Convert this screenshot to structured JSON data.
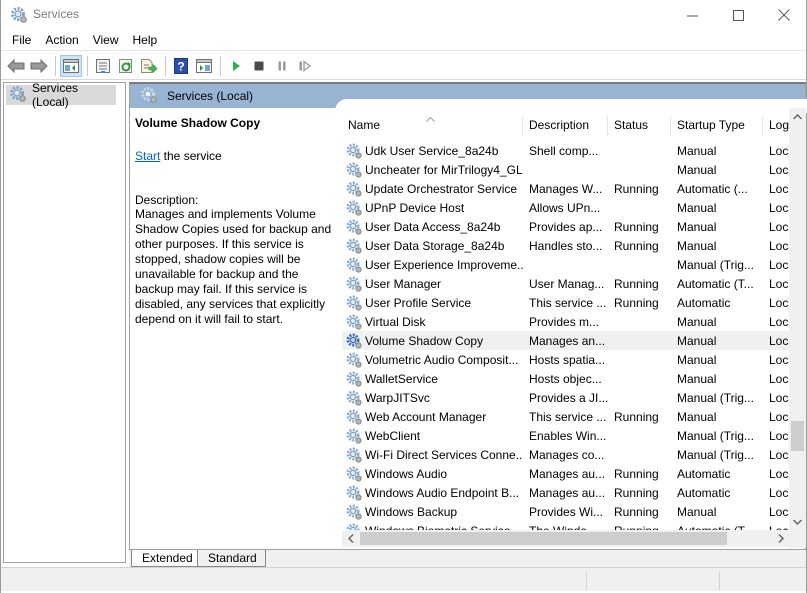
{
  "window": {
    "title": "Services",
    "app_icon": "services-gear-icon",
    "controls": {
      "minimize": "minimize-icon",
      "maximize": "maximize-icon",
      "close": "close-icon"
    }
  },
  "menubar": {
    "items": [
      {
        "label": "File"
      },
      {
        "label": "Action"
      },
      {
        "label": "View"
      },
      {
        "label": "Help"
      }
    ]
  },
  "toolbar": {
    "buttons": [
      {
        "name": "back",
        "icon": "back-arrow-icon"
      },
      {
        "name": "forward",
        "icon": "forward-arrow-icon"
      },
      {
        "name": "show-hide-console-tree",
        "icon": "console-tree-icon",
        "active": true
      },
      {
        "name": "properties",
        "icon": "properties-icon"
      },
      {
        "name": "refresh",
        "icon": "refresh-icon"
      },
      {
        "name": "export-list",
        "icon": "export-list-icon"
      },
      {
        "name": "help",
        "icon": "help-icon"
      },
      {
        "name": "show-hide-action-pane",
        "icon": "action-pane-icon"
      },
      {
        "name": "start-service",
        "icon": "play-icon"
      },
      {
        "name": "stop-service",
        "icon": "stop-icon"
      },
      {
        "name": "pause-service",
        "icon": "pause-icon"
      },
      {
        "name": "resume-service",
        "icon": "resume-icon"
      }
    ]
  },
  "tree": {
    "items": [
      {
        "label": "Services (Local)",
        "selected": true
      }
    ]
  },
  "main": {
    "header": "Services (Local)",
    "detail": {
      "service_name": "Volume Shadow Copy",
      "start_link": "Start",
      "start_suffix": " the service",
      "description_label": "Description:",
      "description": "Manages and implements Volume Shadow Copies used for backup and other purposes. If this service is stopped, shadow copies will be unavailable for backup and the backup may fail. If this service is disabled, any services that explicitly depend on it will fail to start."
    },
    "table": {
      "sort_indicator": "^",
      "columns": [
        "Name",
        "Description",
        "Status",
        "Startup Type",
        "Log"
      ],
      "rows": [
        {
          "name": "Udk User Service_8a24b",
          "description": "Shell comp...",
          "status": "",
          "startup": "Manual",
          "log": "Loca"
        },
        {
          "name": "Uncheater for MirTrilogy4_GL",
          "description": "",
          "status": "",
          "startup": "Manual",
          "log": "Loca"
        },
        {
          "name": "Update Orchestrator Service",
          "description": "Manages W...",
          "status": "Running",
          "startup": "Automatic (...",
          "log": "Loca"
        },
        {
          "name": "UPnP Device Host",
          "description": "Allows UPn...",
          "status": "",
          "startup": "Manual",
          "log": "Loca"
        },
        {
          "name": "User Data Access_8a24b",
          "description": "Provides ap...",
          "status": "Running",
          "startup": "Manual",
          "log": "Loca"
        },
        {
          "name": "User Data Storage_8a24b",
          "description": "Handles sto...",
          "status": "Running",
          "startup": "Manual",
          "log": "Loca"
        },
        {
          "name": "User Experience Improveme...",
          "description": "",
          "status": "",
          "startup": "Manual (Trig...",
          "log": "Loca"
        },
        {
          "name": "User Manager",
          "description": "User Manag...",
          "status": "Running",
          "startup": "Automatic (T...",
          "log": "Loca"
        },
        {
          "name": "User Profile Service",
          "description": "This service ...",
          "status": "Running",
          "startup": "Automatic",
          "log": "Loca"
        },
        {
          "name": "Virtual Disk",
          "description": "Provides m...",
          "status": "",
          "startup": "Manual",
          "log": "Loca"
        },
        {
          "name": "Volume Shadow Copy",
          "description": "Manages an...",
          "status": "",
          "startup": "Manual",
          "log": "Loca",
          "selected": true
        },
        {
          "name": "Volumetric Audio Composit...",
          "description": "Hosts spatia...",
          "status": "",
          "startup": "Manual",
          "log": "Loca"
        },
        {
          "name": "WalletService",
          "description": "Hosts objec...",
          "status": "",
          "startup": "Manual",
          "log": "Loca"
        },
        {
          "name": "WarpJITSvc",
          "description": "Provides a JI...",
          "status": "",
          "startup": "Manual (Trig...",
          "log": "Loca"
        },
        {
          "name": "Web Account Manager",
          "description": "This service ...",
          "status": "Running",
          "startup": "Manual",
          "log": "Loca"
        },
        {
          "name": "WebClient",
          "description": "Enables Win...",
          "status": "",
          "startup": "Manual (Trig...",
          "log": "Loca"
        },
        {
          "name": "Wi-Fi Direct Services Conne...",
          "description": "Manages co...",
          "status": "",
          "startup": "Manual (Trig...",
          "log": "Loca"
        },
        {
          "name": "Windows Audio",
          "description": "Manages au...",
          "status": "Running",
          "startup": "Automatic",
          "log": "Loca"
        },
        {
          "name": "Windows Audio Endpoint B...",
          "description": "Manages au...",
          "status": "Running",
          "startup": "Automatic",
          "log": "Loca"
        },
        {
          "name": "Windows Backup",
          "description": "Provides Wi...",
          "status": "Running",
          "startup": "Manual",
          "log": "Loca"
        },
        {
          "name": "Windows Biometric Service",
          "description": "The Windo...",
          "status": "Running",
          "startup": "Automatic (T...",
          "log": "Loca"
        }
      ]
    },
    "scroll": {
      "vertical_position_fraction": 0.78,
      "horizontal_position_fraction": 0.0
    }
  },
  "tabs": [
    {
      "label": "Extended",
      "active": true
    },
    {
      "label": "Standard",
      "active": false
    }
  ],
  "colors": {
    "header_band": "#98b4d3",
    "link": "#0066cc",
    "selected_row": "#f0f0f0",
    "tree_selected": "#d9d9d9",
    "play_green": "#2bb24c"
  }
}
